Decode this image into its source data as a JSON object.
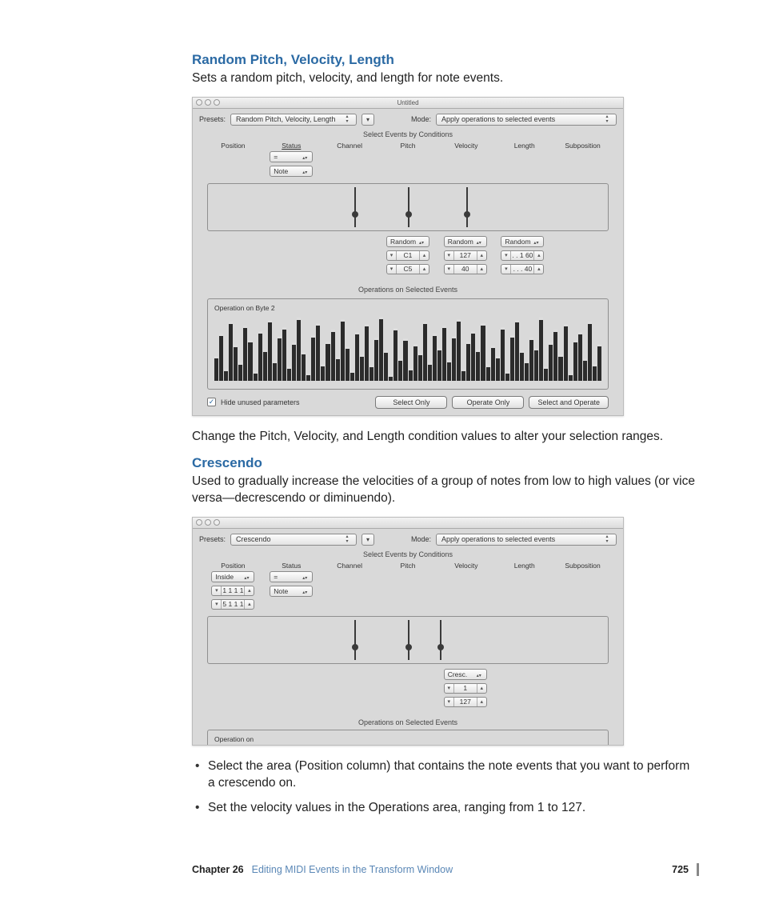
{
  "sections": {
    "s1": {
      "title": "Random Pitch, Velocity, Length",
      "para1": "Sets a random pitch, velocity, and length for note events.",
      "para2": "Change the Pitch, Velocity, and Length condition values to alter your selection ranges."
    },
    "s2": {
      "title": "Crescendo",
      "para1": "Used to gradually increase the velocities of a group of notes from low to high values (or vice versa—decrescendo or diminuendo).",
      "bullets": [
        "Select the area (Position column) that contains the note events that you want to perform a crescendo on.",
        "Set the velocity values in the Operations area, ranging from 1 to 127."
      ]
    }
  },
  "shot1": {
    "title": "Untitled",
    "presets_label": "Presets:",
    "preset_value": "Random Pitch, Velocity, Length",
    "mode_label": "Mode:",
    "mode_value": "Apply operations to selected events",
    "cond_title": "Select Events by Conditions",
    "columns": [
      "Position",
      "Status",
      "Channel",
      "Pitch",
      "Velocity",
      "Length",
      "Subposition"
    ],
    "status_op": "=",
    "status_val": "Note",
    "ops_title": "Operations on Selected Events",
    "op_random": "Random",
    "pitch_lo": "C1",
    "pitch_hi": "C5",
    "vel_lo": "127",
    "vel_hi": "40",
    "len_lo": ". . 1 60",
    "len_hi": ". . . 40",
    "byte2_label": "Operation on Byte 2",
    "hide_label": "Hide unused parameters",
    "btn1": "Select Only",
    "btn2": "Operate Only",
    "btn3": "Select and Operate"
  },
  "shot2": {
    "presets_label": "Presets:",
    "preset_value": "Crescendo",
    "mode_label": "Mode:",
    "mode_value": "Apply operations to selected events",
    "cond_title": "Select Events by Conditions",
    "columns": [
      "Position",
      "Status",
      "Channel",
      "Pitch",
      "Velocity",
      "Length",
      "Subposition"
    ],
    "pos_op": "Inside",
    "pos_a": "1 1 1 1",
    "pos_b": "5 1 1 1",
    "status_op": "=",
    "status_val": "Note",
    "op_cresc": "Cresc.",
    "cresc_a": "1",
    "cresc_b": "127",
    "ops_title": "Operations on Selected Events",
    "opon_label": "Operation on"
  },
  "chart_data": {
    "type": "bar",
    "title": "Operation on Byte 2",
    "ylim": [
      0,
      100
    ],
    "values": [
      38,
      72,
      18,
      90,
      55,
      28,
      84,
      62,
      14,
      76,
      48,
      92,
      30,
      68,
      82,
      22,
      58,
      96,
      44,
      12,
      70,
      88,
      26,
      60,
      78,
      36,
      94,
      52,
      16,
      74,
      40,
      86,
      24,
      66,
      98,
      46,
      10,
      80,
      34,
      64,
      20,
      56,
      42,
      90,
      28,
      72,
      50,
      84,
      32,
      68,
      94,
      18,
      60,
      76,
      48,
      88,
      24,
      54,
      38,
      82,
      14,
      70,
      92,
      46,
      30,
      66,
      50,
      96,
      22,
      58,
      78,
      40,
      86,
      12,
      62,
      74,
      34,
      90,
      26,
      56
    ]
  },
  "footer": {
    "chapter": "Chapter 26",
    "title": "Editing MIDI Events in the Transform Window",
    "page": "725"
  }
}
